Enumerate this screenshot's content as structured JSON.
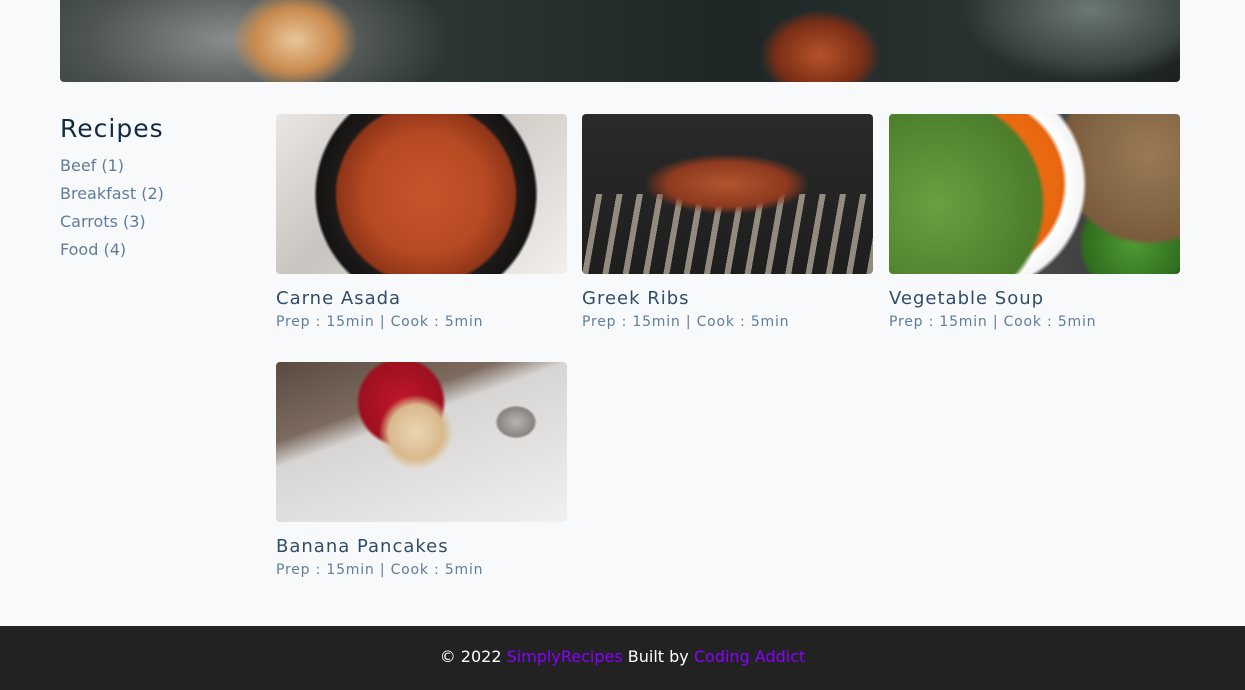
{
  "sidebar": {
    "heading": "Recipes",
    "tags": [
      "Beef (1)",
      "Breakfast (2)",
      "Carrots (3)",
      "Food (4)"
    ]
  },
  "recipes": [
    {
      "title": "Carne Asada",
      "meta": "Prep : 15min | Cook : 5min"
    },
    {
      "title": "Greek Ribs",
      "meta": "Prep : 15min | Cook : 5min"
    },
    {
      "title": "Vegetable Soup",
      "meta": "Prep : 15min | Cook : 5min"
    },
    {
      "title": "Banana Pancakes",
      "meta": "Prep : 15min | Cook : 5min"
    }
  ],
  "footer": {
    "copyright": "© 2022",
    "site_name": "SimplyRecipes",
    "built_by": "Built by",
    "author": "Coding Addict"
  },
  "colors": {
    "accent": "#8a00ff",
    "footer_bg": "#222222",
    "page_bg": "#f8f9fb"
  }
}
